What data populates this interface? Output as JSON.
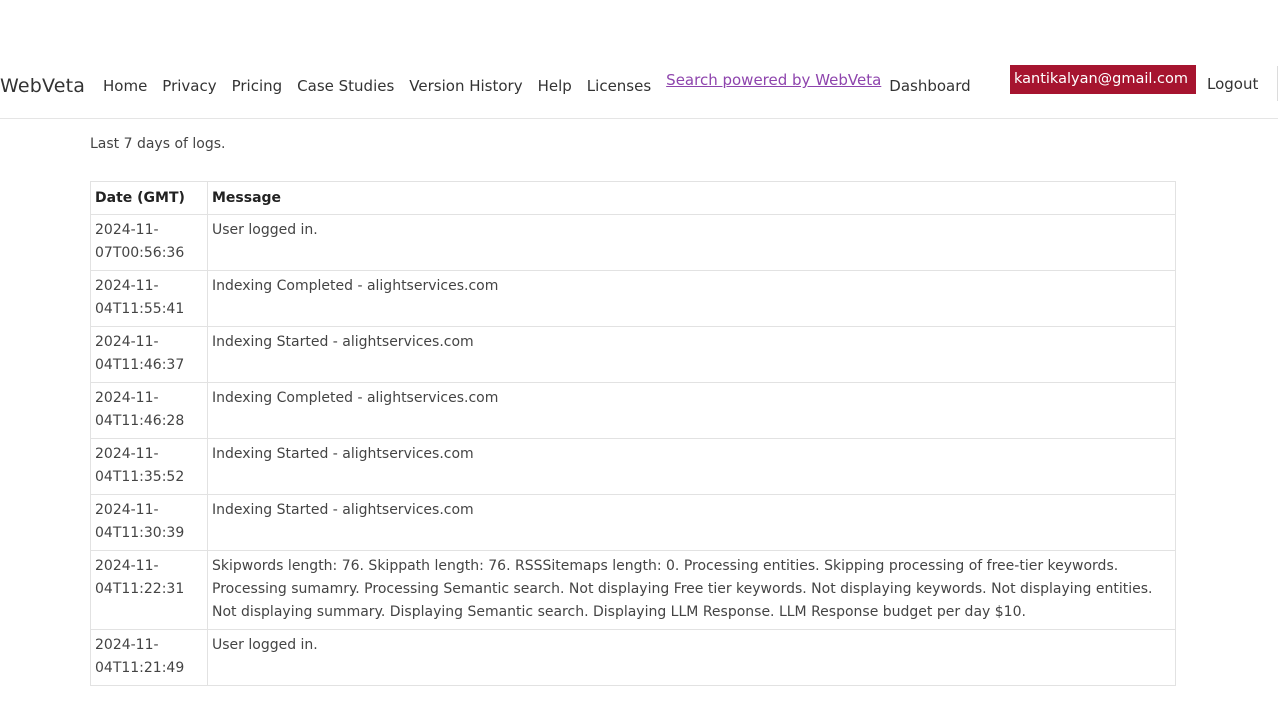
{
  "header": {
    "brand": "WebVeta",
    "nav": [
      {
        "label": "Home"
      },
      {
        "label": "Privacy"
      },
      {
        "label": "Pricing"
      },
      {
        "label": "Case Studies"
      },
      {
        "label": "Version History"
      },
      {
        "label": "Help"
      },
      {
        "label": "Licenses"
      },
      {
        "label": "Search powered by WebVeta"
      },
      {
        "label": "Dashboard"
      }
    ],
    "user_email": "kantikalyan@gmail.com",
    "logout": "Logout"
  },
  "main": {
    "intro": "Last 7 days of logs.",
    "table": {
      "columns": [
        "Date (GMT)",
        "Message"
      ],
      "rows": [
        {
          "date": "2024-11-07T00:56:36",
          "message": "User logged in."
        },
        {
          "date": "2024-11-04T11:55:41",
          "message": "Indexing Completed - alightservices.com"
        },
        {
          "date": "2024-11-04T11:46:37",
          "message": "Indexing Started - alightservices.com"
        },
        {
          "date": "2024-11-04T11:46:28",
          "message": "Indexing Completed - alightservices.com"
        },
        {
          "date": "2024-11-04T11:35:52",
          "message": "Indexing Started - alightservices.com"
        },
        {
          "date": "2024-11-04T11:30:39",
          "message": "Indexing Started - alightservices.com"
        },
        {
          "date": "2024-11-04T11:22:31",
          "message": "Skipwords length: 76. Skippath length: 76. RSSSitemaps length: 0. Processing entities. Skipping processing of free-tier keywords. Processing sumamry. Processing Semantic search. Not displaying Free tier keywords. Not displaying keywords. Not displaying entities. Not displaying summary. Displaying Semantic search. Displaying LLM Response. LLM Response budget per day $10."
        },
        {
          "date": "2024-11-04T11:21:49",
          "message": "User logged in."
        }
      ]
    }
  },
  "colors": {
    "user_badge_bg": "#a6142f",
    "link_accent": "#8e44ad"
  }
}
